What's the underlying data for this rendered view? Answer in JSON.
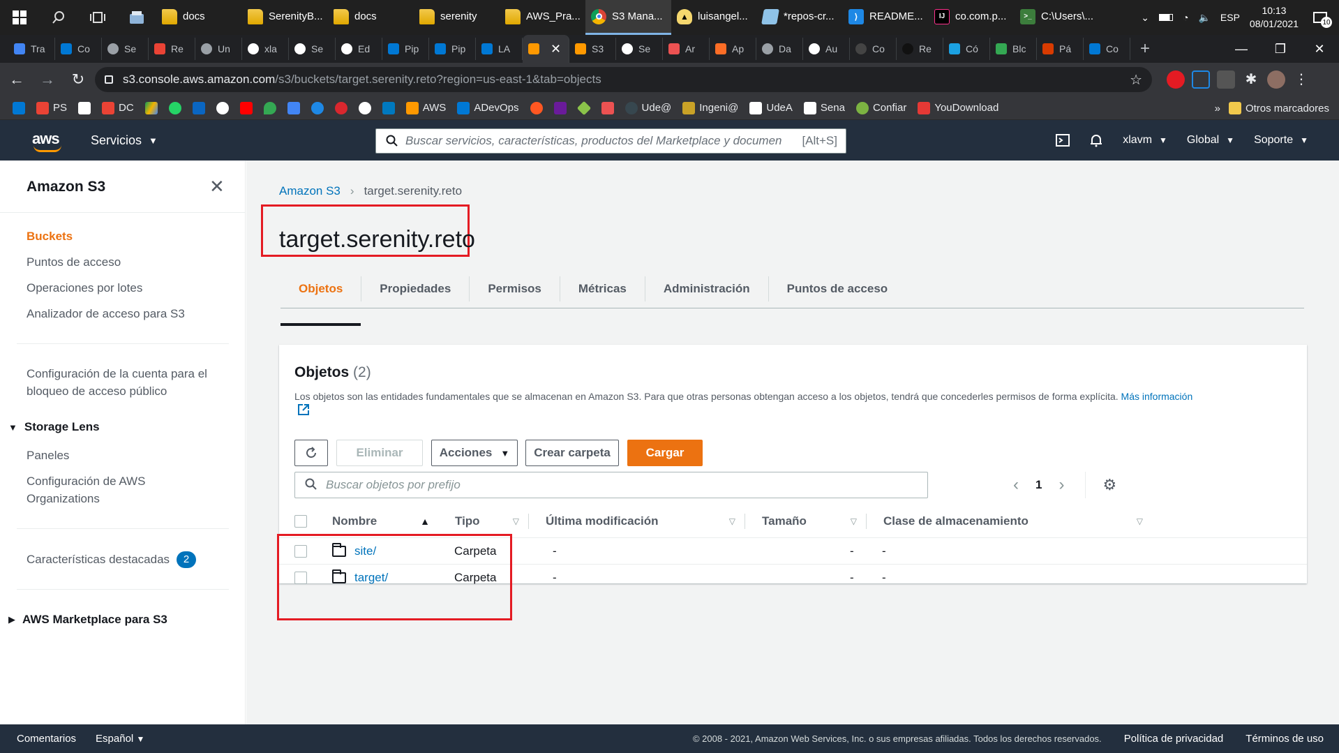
{
  "taskbar": {
    "apps": [
      {
        "label": "docs",
        "kind": "folder"
      },
      {
        "label": "SerenityB...",
        "kind": "folder"
      },
      {
        "label": "docs",
        "kind": "folder"
      },
      {
        "label": "serenity",
        "kind": "folder"
      },
      {
        "label": "AWS_Pra...",
        "kind": "folder"
      },
      {
        "label": "S3 Mana...",
        "kind": "chrome"
      },
      {
        "label": "luisangel...",
        "kind": "linux"
      },
      {
        "label": "*repos-cr...",
        "kind": "notepad"
      },
      {
        "label": "README...",
        "kind": "vscode"
      },
      {
        "label": "co.com.p...",
        "kind": "intellij"
      },
      {
        "label": "C:\\Users\\...",
        "kind": "cmd"
      }
    ],
    "lang": "ESP",
    "time": "10:13",
    "date": "08/01/2021",
    "notifications": "10"
  },
  "browser": {
    "tabs": [
      "Tra",
      "Co",
      "Se",
      "Re",
      "Un",
      "xla",
      "Se",
      "Ed",
      "Pip",
      "Pip",
      "LA",
      "",
      "S3",
      "Se",
      "Ar",
      "Ap",
      "Da",
      "Au",
      "Co",
      "Re",
      "Có",
      "Blc",
      "Pá",
      "Co"
    ],
    "url_host": "s3.console.aws.amazon.com",
    "url_path": "/s3/buckets/target.serenity.reto?region=us-east-1&tab=objects",
    "bookmarks": [
      "PS",
      "",
      "DC",
      "",
      "",
      "",
      "",
      "",
      "",
      "",
      "",
      "",
      "",
      "",
      "AWS",
      "ADevOps",
      "",
      "",
      "",
      "",
      "Ude@",
      "Ingeni@",
      "UdeA",
      "Sena",
      "Confiar",
      "YouDownload"
    ],
    "bookmarks_more": "»",
    "other_bookmarks": "Otros marcadores"
  },
  "aws_header": {
    "logo": "aws",
    "services": "Servicios",
    "search_placeholder": "Buscar servicios, características, productos del Marketplace y documen",
    "search_shortcut": "[Alt+S]",
    "user": "xlavm",
    "region": "Global",
    "support": "Soporte"
  },
  "sidebar": {
    "title": "Amazon S3",
    "items": [
      "Buckets",
      "Puntos de acceso",
      "Operaciones por lotes",
      "Analizador de acceso para S3"
    ],
    "block_public": "Configuración de la cuenta para el bloqueo de acceso público",
    "storage_lens": "Storage Lens",
    "storage_lens_items": [
      "Paneles",
      "Configuración de AWS Organizations"
    ],
    "featured": "Características destacadas",
    "featured_count": "2",
    "marketplace": "AWS Marketplace para S3"
  },
  "breadcrumb": {
    "root": "Amazon S3",
    "current": "target.serenity.reto"
  },
  "page_title": "target.serenity.reto",
  "tabs": [
    "Objetos",
    "Propiedades",
    "Permisos",
    "Métricas",
    "Administración",
    "Puntos de acceso"
  ],
  "objects_panel": {
    "title": "Objetos",
    "count": "(2)",
    "description": "Los objetos son las entidades fundamentales que se almacenan en Amazon S3. Para que otras personas obtengan acceso a los objetos, tendrá que concederles permisos de forma explícita.",
    "more_info": "Más información",
    "buttons": {
      "refresh": "refresh",
      "delete": "Eliminar",
      "actions": "Acciones",
      "create_folder": "Crear carpeta",
      "upload": "Cargar"
    },
    "search_placeholder": "Buscar objetos por prefijo",
    "page": "1",
    "columns": [
      "Nombre",
      "Tipo",
      "Última modificación",
      "Tamaño",
      "Clase de almacenamiento"
    ],
    "rows": [
      {
        "name": "site/",
        "type": "Carpeta",
        "modified": "-",
        "size": "-",
        "class": "-"
      },
      {
        "name": "target/",
        "type": "Carpeta",
        "modified": "-",
        "size": "-",
        "class": "-"
      }
    ]
  },
  "footer": {
    "feedback": "Comentarios",
    "language": "Español",
    "copyright": "© 2008 - 2021, Amazon Web Services, Inc. o sus empresas afiliadas. Todos los derechos reservados.",
    "privacy": "Política de privacidad",
    "terms": "Términos de uso"
  },
  "colors": {
    "aws_nav": "#232f3e",
    "accent_orange": "#ec7211",
    "link_blue": "#0073bb",
    "highlight_red": "#e41b23"
  }
}
